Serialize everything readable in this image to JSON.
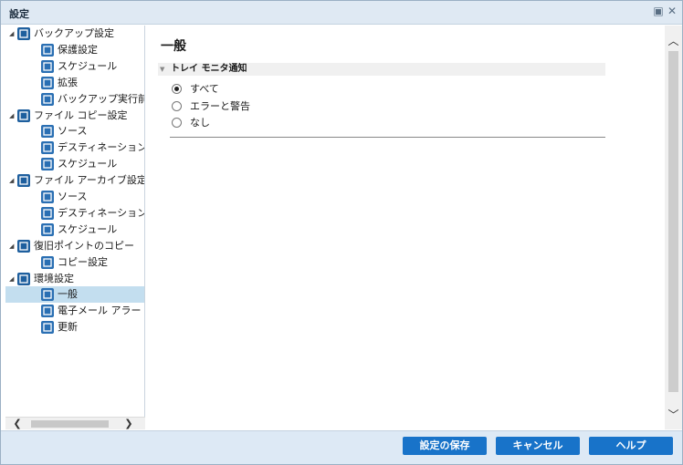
{
  "window": {
    "title": "設定"
  },
  "tree": {
    "items": [
      {
        "label": "バックアップ設定",
        "level": 0,
        "expanded": true,
        "icon": "backup-icon"
      },
      {
        "label": "保護設定",
        "level": 1,
        "icon": "protection-icon"
      },
      {
        "label": "スケジュール",
        "level": 1,
        "icon": "schedule-icon"
      },
      {
        "label": "拡張",
        "level": 1,
        "icon": "advanced-icon"
      },
      {
        "label": "バックアップ実行前/後の",
        "level": 1,
        "icon": "wrench-icon"
      },
      {
        "label": "ファイル コピー設定",
        "level": 0,
        "expanded": true,
        "icon": "file-copy-icon"
      },
      {
        "label": "ソース",
        "level": 1,
        "icon": "source-icon"
      },
      {
        "label": "デスティネーション",
        "level": 1,
        "icon": "destination-icon"
      },
      {
        "label": "スケジュール",
        "level": 1,
        "icon": "schedule-icon"
      },
      {
        "label": "ファイル アーカイブ設定",
        "level": 0,
        "expanded": true,
        "icon": "file-archive-icon"
      },
      {
        "label": "ソース",
        "level": 1,
        "icon": "source-icon"
      },
      {
        "label": "デスティネーション",
        "level": 1,
        "icon": "destination-icon"
      },
      {
        "label": "スケジュール",
        "level": 1,
        "icon": "schedule-icon"
      },
      {
        "label": "復旧ポイントのコピー",
        "level": 0,
        "expanded": true,
        "icon": "recovery-point-icon"
      },
      {
        "label": "コピー設定",
        "level": 1,
        "icon": "copy-settings-icon"
      },
      {
        "label": "環境設定",
        "level": 0,
        "expanded": true,
        "icon": "preferences-icon"
      },
      {
        "label": "一般",
        "level": 1,
        "icon": "general-icon",
        "selected": true
      },
      {
        "label": "電子メール アラート",
        "level": 1,
        "icon": "email-icon"
      },
      {
        "label": "更新",
        "level": 1,
        "icon": "update-icon"
      }
    ]
  },
  "content": {
    "title": "一般",
    "section": "トレイ モニタ通知",
    "options": [
      {
        "label": "すべて",
        "checked": true
      },
      {
        "label": "エラーと警告",
        "checked": false
      },
      {
        "label": "なし",
        "checked": false
      }
    ]
  },
  "footer": {
    "save": "設定の保存",
    "cancel": "キャンセル",
    "help": "ヘルプ"
  },
  "colors": {
    "accent": "#1873c9",
    "selection": "#c3deef",
    "titlebar": "#dfe9f3",
    "footer": "#dde9f5"
  }
}
